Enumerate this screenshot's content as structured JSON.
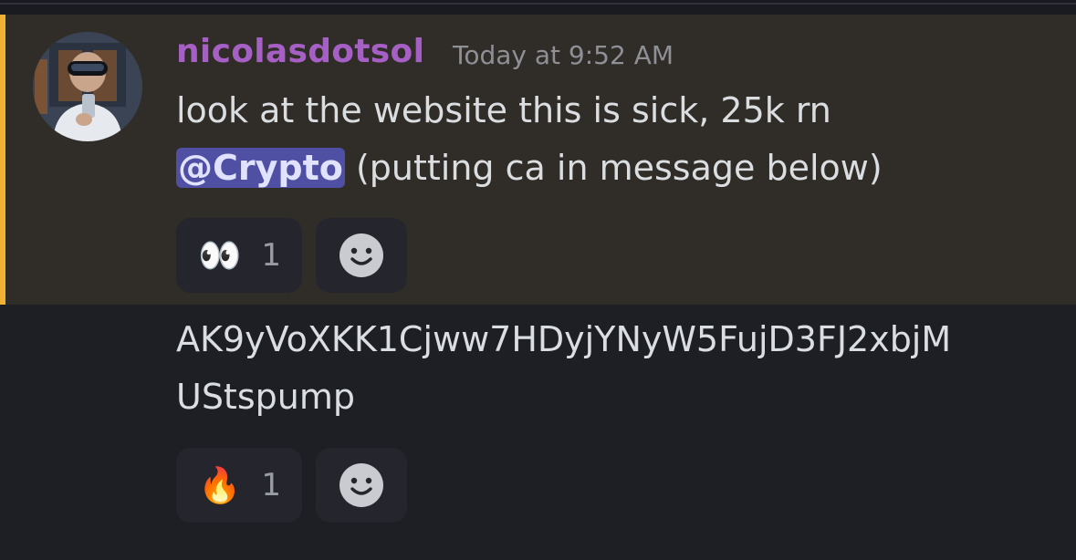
{
  "message": {
    "author": "nicolasdotsol",
    "timestamp": "Today at 9:52 AM",
    "line1": "look at the website this is sick, 25k rn",
    "mention": "@Crypto",
    "line2_rest": " (putting ca in message below)",
    "reactions": [
      {
        "emoji": "👀",
        "emoji_name": "eyes-emoji",
        "count": "1"
      }
    ]
  },
  "followup": {
    "line1": "AK9yVoXKK1Cjww7HDyjYNyW5FujD3FJ2xbjM",
    "line2": "UStspump",
    "reactions": [
      {
        "emoji": "🔥",
        "emoji_name": "fire-emoji",
        "count": "1"
      }
    ]
  },
  "colors": {
    "highlight_bg": "#302c27",
    "highlight_bar": "#f0b232",
    "username": "#a65fc4",
    "mention_bg": "#4f4fa3",
    "background": "#1e1f25"
  },
  "icons": {
    "add_reaction": "smiley-face-icon",
    "avatar": "user-avatar-photo"
  }
}
